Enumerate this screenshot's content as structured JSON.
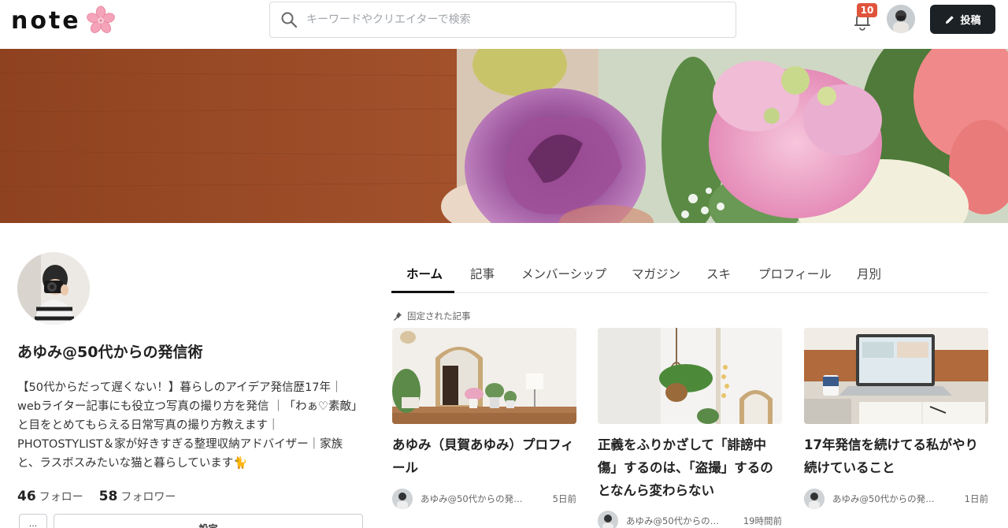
{
  "header": {
    "logo_text": "note",
    "search": {
      "placeholder": "キーワードやクリエイターで検索",
      "value": ""
    },
    "notification_count": "10",
    "post_button_label": "投稿"
  },
  "profile": {
    "name": "あゆみ@50代からの発信術",
    "bio": "【50代からだって遅くない！】暮らしのアイデア発信歴17年｜webライター記事にも役立つ写真の撮り方を発信 ｜「わぁ♡素敵」と目をとめてもらえる日常写真の撮り方教えます｜PHOTOSTYLIST＆家が好きすぎる整理収納アドバイザー｜家族と、ラスボスみたいな猫と暮らしています🐈",
    "follow_count": "46",
    "follow_label": "フォロー",
    "follower_count": "58",
    "follower_label": "フォロワー",
    "more_button_label": "···",
    "settings_button_label": "設定"
  },
  "tabs": [
    {
      "label": "ホーム",
      "active": true
    },
    {
      "label": "記事",
      "active": false
    },
    {
      "label": "メンバーシップ",
      "active": false
    },
    {
      "label": "マガジン",
      "active": false
    },
    {
      "label": "スキ",
      "active": false
    },
    {
      "label": "プロフィール",
      "active": false
    },
    {
      "label": "月別",
      "active": false
    }
  ],
  "pinned_label": "固定された記事",
  "articles": [
    {
      "title": "あゆみ（貝賀あゆみ）プロフィール",
      "author": "あゆみ@50代からの発…",
      "time": "5日前"
    },
    {
      "title": "正義をふりかざして「誹謗中傷」するのは、「盗撮」するのとなんら変わらない",
      "author": "あゆみ@50代からの…",
      "time": "19時間前"
    },
    {
      "title": "17年発信を続けてる私がやり続けていること",
      "author": "あゆみ@50代からの発…",
      "time": "1日前"
    }
  ],
  "colors": {
    "accent_dark": "#1c2125",
    "badge_red": "#e0533c",
    "cover_wood": "#9b4a26"
  }
}
